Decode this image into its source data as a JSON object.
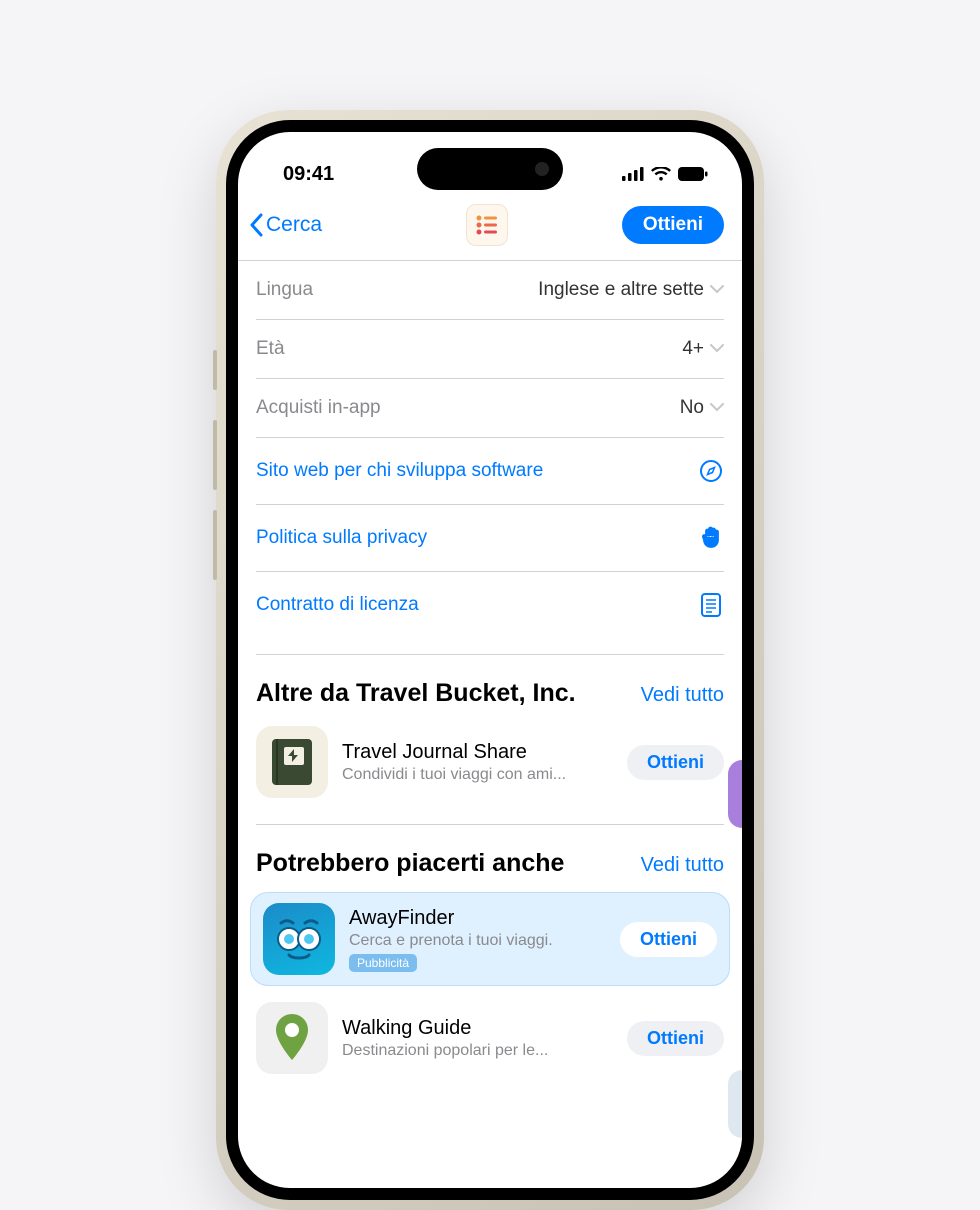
{
  "status": {
    "time": "09:41"
  },
  "nav": {
    "back": "Cerca",
    "get": "Ottieni"
  },
  "info": {
    "language_label": "Lingua",
    "language_value": "Inglese e altre sette",
    "age_label": "Età",
    "age_value": "4+",
    "iap_label": "Acquisti in-app",
    "iap_value": "No"
  },
  "links": {
    "dev_site": "Sito web per chi sviluppa software",
    "privacy": "Politica sulla privacy",
    "license": "Contratto di licenza"
  },
  "section_more": {
    "title": "Altre da Travel Bucket, Inc.",
    "see_all": "Vedi tutto",
    "app": {
      "name": "Travel Journal Share",
      "sub": "Condividi i tuoi viaggi con ami...",
      "get": "Ottieni"
    }
  },
  "section_like": {
    "title": "Potrebbero piacerti anche",
    "see_all": "Vedi tutto",
    "apps": [
      {
        "name": "AwayFinder",
        "sub": "Cerca e prenota i tuoi viaggi.",
        "ad_badge": "Pubblicità",
        "get": "Ottieni"
      },
      {
        "name": "Walking Guide",
        "sub": "Destinazioni popolari per le...",
        "get": "Ottieni"
      }
    ]
  }
}
